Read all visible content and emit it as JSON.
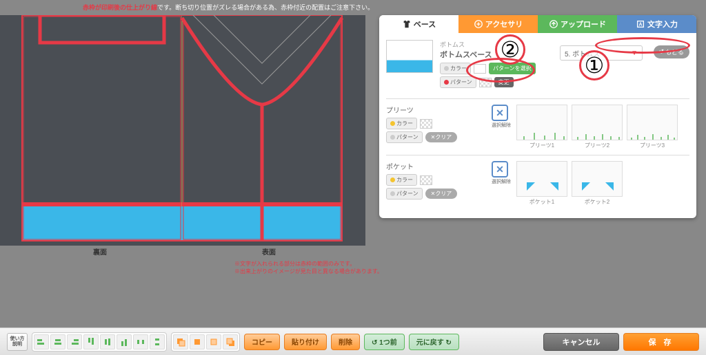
{
  "warning": {
    "red_part": "赤枠が印刷後の仕上がり線",
    "rest": "です。断ち切り位置がズレる場合がある為、赤枠付近の配置はご注意下さい。"
  },
  "canvas": {
    "back_label": "裏面",
    "front_label": "表面",
    "note1": "※文字が入れられる部分は赤枠の範囲のみです。",
    "note2": "※出来上がりのイメージが見た目と異なる場合があります。"
  },
  "tabs": {
    "base": "ベース",
    "accessory": "アクセサリ",
    "upload": "アップロード",
    "text": "文字入力"
  },
  "header": {
    "category": "ボトムス",
    "title": "ボトムスベース",
    "color_btn": "カラー",
    "pattern_btn": "パターン",
    "select_pattern": "パターンを選択",
    "change": "変更",
    "dropdown": "5. ボトムス",
    "back": "もどる"
  },
  "sections": {
    "pleats": {
      "title": "プリーツ",
      "color_btn": "カラー",
      "pattern_btn": "パターン",
      "clear": "クリア",
      "deselect": "選択解除",
      "items": [
        "プリーツ1",
        "プリーツ2",
        "プリーツ3"
      ]
    },
    "pocket": {
      "title": "ポケット",
      "color_btn": "カラー",
      "pattern_btn": "パターン",
      "clear": "クリア",
      "deselect": "選択解除",
      "items": [
        "ポケット1",
        "ポケット2"
      ]
    }
  },
  "annotations": {
    "one": "①",
    "two": "②"
  },
  "toolbar": {
    "help": "使い方\n説明",
    "copy": "コピー",
    "paste": "貼り付け",
    "delete": "削除",
    "undo": "1つ前",
    "reset": "元に戻す",
    "cancel": "キャンセル",
    "save": "保 存"
  }
}
